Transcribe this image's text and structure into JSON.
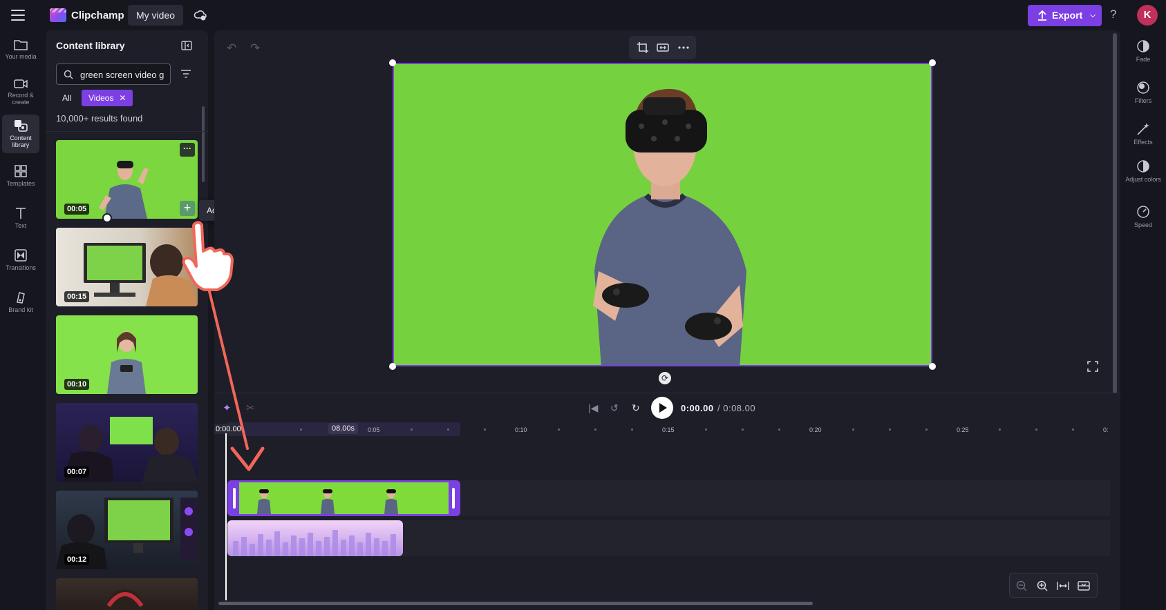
{
  "topbar": {
    "app_name": "Clipchamp",
    "video_name": "My video",
    "export_label": "Export",
    "avatar_initial": "K",
    "help": "?"
  },
  "leftrail": {
    "items": [
      {
        "label": "Your media",
        "icon": "folder-icon"
      },
      {
        "label": "Record & create",
        "icon": "camera-icon"
      },
      {
        "label": "Content library",
        "icon": "library-icon",
        "active": true
      },
      {
        "label": "Templates",
        "icon": "templates-icon"
      },
      {
        "label": "Text",
        "icon": "text-icon"
      },
      {
        "label": "Transitions",
        "icon": "transitions-icon"
      },
      {
        "label": "Brand kit",
        "icon": "brand-kit-icon"
      }
    ]
  },
  "library": {
    "title": "Content library",
    "search_value": "green screen video g",
    "chip_all": "All",
    "chip_videos": "Videos",
    "results": "10,000+ results found",
    "thumbnails": [
      {
        "duration": "00:05"
      },
      {
        "duration": "00:15"
      },
      {
        "duration": "00:10"
      },
      {
        "duration": "00:07"
      },
      {
        "duration": "00:12"
      }
    ],
    "tooltip": "Add to timeline"
  },
  "rightrail": {
    "items": [
      {
        "label": "Fade",
        "icon": "fade-icon"
      },
      {
        "label": "Filters",
        "icon": "filters-icon"
      },
      {
        "label": "Effects",
        "icon": "effects-icon"
      },
      {
        "label": "Adjust colors",
        "icon": "adjust-colors-icon"
      },
      {
        "label": "Speed",
        "icon": "speed-icon"
      }
    ]
  },
  "timeline": {
    "current_time": "0:00.00",
    "total_time": "/ 0:08.00",
    "start_label": "0:00.00",
    "clip_duration": "08.00s",
    "ruler": [
      "0:05",
      "0:10",
      "0:15",
      "0:20",
      "0:25",
      "0:"
    ]
  },
  "colors": {
    "accent": "#7b3fe4",
    "green_screen": "#76d13f",
    "annotation": "#f2665a"
  }
}
